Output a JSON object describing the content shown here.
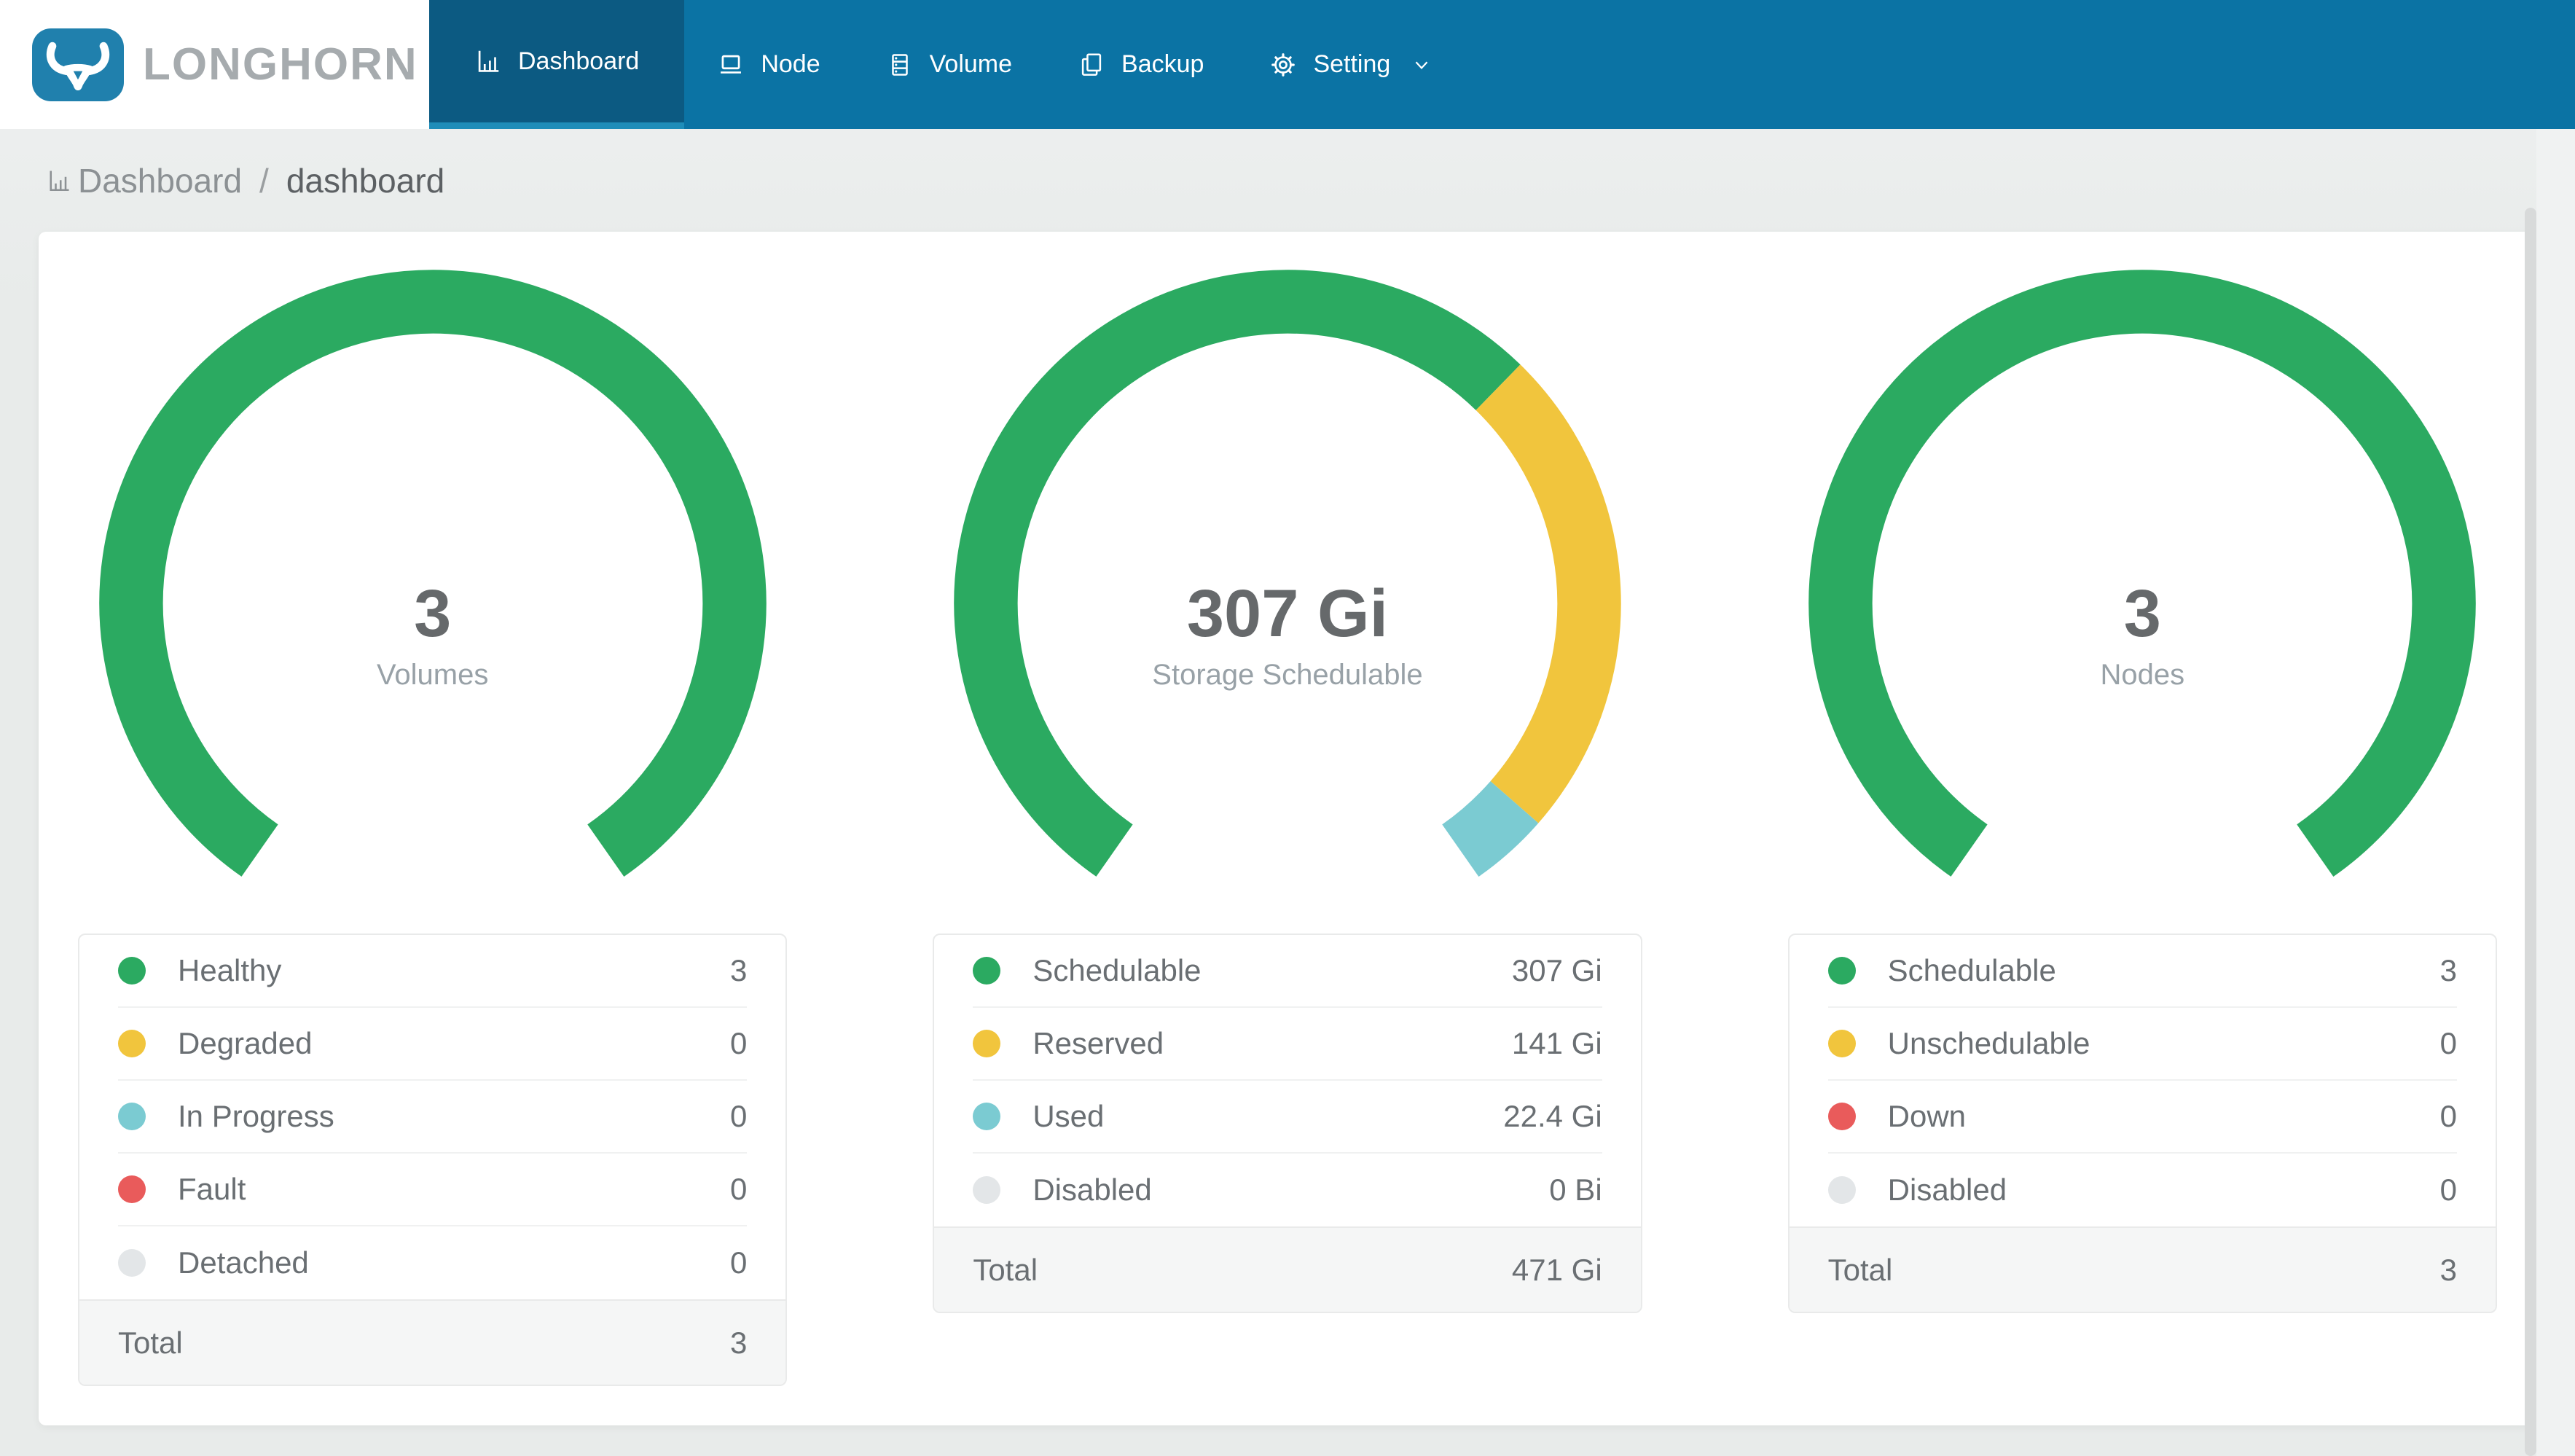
{
  "brand": {
    "name": "LONGHORN"
  },
  "nav": {
    "items": [
      {
        "label": "Dashboard",
        "active": true
      },
      {
        "label": "Node",
        "active": false
      },
      {
        "label": "Volume",
        "active": false
      },
      {
        "label": "Backup",
        "active": false
      },
      {
        "label": "Setting",
        "active": false
      }
    ]
  },
  "breadcrumb": {
    "section": "Dashboard",
    "separator": "/",
    "page": "dashboard"
  },
  "colors": {
    "navbar": "#0b73a4",
    "navbar_active": "#0c5a82",
    "navbar_active_border": "#1f8db9",
    "logo_tile": "#2080ad",
    "green": "#2baa61",
    "yellow": "#f1c53d",
    "teal": "#7bcbd2",
    "red": "#e95b5b",
    "gray": "#e3e6e8"
  },
  "chart_data": [
    {
      "type": "gauge-donut",
      "title": "Volumes",
      "center_value": "3",
      "span_degrees": 290,
      "legend_position": "bottom",
      "segments": [
        {
          "label": "Healthy",
          "value": 3,
          "display": "3",
          "color": "#2baa61"
        },
        {
          "label": "Degraded",
          "value": 0,
          "display": "0",
          "color": "#f1c53d"
        },
        {
          "label": "In Progress",
          "value": 0,
          "display": "0",
          "color": "#7bcbd2"
        },
        {
          "label": "Fault",
          "value": 0,
          "display": "0",
          "color": "#e95b5b"
        },
        {
          "label": "Detached",
          "value": 0,
          "display": "0",
          "color": "#e3e6e8"
        }
      ],
      "total": {
        "label": "Total",
        "value": 3,
        "display": "3"
      }
    },
    {
      "type": "gauge-donut",
      "title": "Storage Schedulable",
      "center_value": "307 Gi",
      "span_degrees": 290,
      "legend_position": "bottom",
      "segments": [
        {
          "label": "Schedulable",
          "value": 307,
          "display": "307 Gi",
          "color": "#2baa61"
        },
        {
          "label": "Reserved",
          "value": 141,
          "display": "141 Gi",
          "color": "#f1c53d"
        },
        {
          "label": "Used",
          "value": 22.4,
          "display": "22.4 Gi",
          "color": "#7bcbd2"
        },
        {
          "label": "Disabled",
          "value": 0,
          "display": "0 Bi",
          "color": "#e3e6e8"
        }
      ],
      "total": {
        "label": "Total",
        "value": 471,
        "display": "471 Gi"
      }
    },
    {
      "type": "gauge-donut",
      "title": "Nodes",
      "center_value": "3",
      "span_degrees": 290,
      "legend_position": "bottom",
      "segments": [
        {
          "label": "Schedulable",
          "value": 3,
          "display": "3",
          "color": "#2baa61"
        },
        {
          "label": "Unschedulable",
          "value": 0,
          "display": "0",
          "color": "#f1c53d"
        },
        {
          "label": "Down",
          "value": 0,
          "display": "0",
          "color": "#e95b5b"
        },
        {
          "label": "Disabled",
          "value": 0,
          "display": "0",
          "color": "#e3e6e8"
        }
      ],
      "total": {
        "label": "Total",
        "value": 3,
        "display": "3"
      }
    }
  ]
}
